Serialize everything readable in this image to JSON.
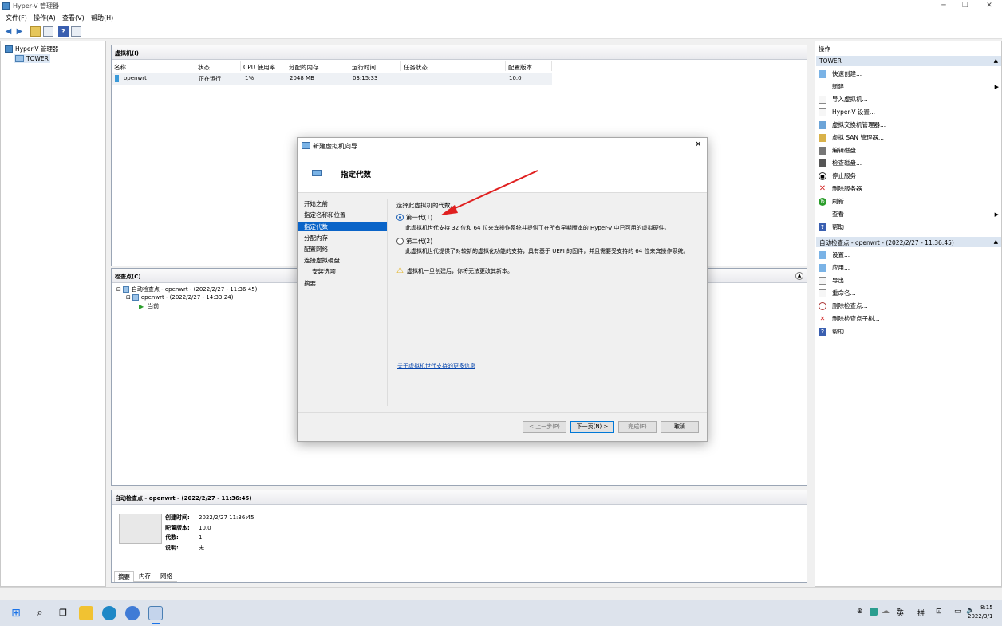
{
  "window": {
    "title": "Hyper-V 管理器",
    "min": "─",
    "max": "❐",
    "close": "✕"
  },
  "menu": [
    "文件(F)",
    "操作(A)",
    "查看(V)",
    "帮助(H)"
  ],
  "tree": {
    "root": "Hyper-V 管理器",
    "server": "TOWER"
  },
  "vmpanel": {
    "title": "虚拟机(I)",
    "columns": [
      "名称",
      "状态",
      "CPU 使用率",
      "分配的内存",
      "运行时间",
      "任务状态",
      "配置版本"
    ],
    "row": [
      "openwrt",
      "正在运行",
      "1%",
      "2048 MB",
      "03:15:33",
      "",
      "10.0"
    ]
  },
  "checkpoints": {
    "title": "检查点(C)",
    "items": [
      "自动检查点 - openwrt - (2022/2/27 - 11:36:45)",
      "openwrt - (2022/2/27 - 14:33:24)",
      "当前"
    ]
  },
  "details": {
    "title": "自动检查点 - openwrt - (2022/2/27 - 11:36:45)",
    "fields": [
      {
        "k": "创建时间:",
        "v": "2022/2/27 11:36:45"
      },
      {
        "k": "配置版本:",
        "v": "10.0"
      },
      {
        "k": "代数:",
        "v": "1"
      },
      {
        "k": "说明:",
        "v": "无"
      }
    ],
    "tabs": [
      "摘要",
      "内存",
      "网络"
    ]
  },
  "actions": {
    "title": "操作",
    "sec1": "TOWER",
    "items1": [
      "快速创建...",
      "新建",
      "导入虚拟机...",
      "Hyper-V 设置...",
      "虚拟交换机管理器...",
      "虚拟 SAN 管理器...",
      "编辑磁盘...",
      "检查磁盘...",
      "停止服务",
      "删除服务器",
      "刷新",
      "查看",
      "帮助"
    ],
    "sec2": "自动检查点 - openwrt - (2022/2/27 - 11:36:45)",
    "items2": [
      "设置...",
      "应用...",
      "导出...",
      "重命名...",
      "删除检查点...",
      "删除检查点子树...",
      "帮助"
    ]
  },
  "dialog": {
    "title": "新建虚拟机向导",
    "heading": "指定代数",
    "nav": [
      "开始之前",
      "指定名称和位置",
      "指定代数",
      "分配内存",
      "配置网络",
      "连接虚拟硬盘",
      "安装选项",
      "摘要"
    ],
    "prompt": "选择此虚拟机的代数。",
    "gen1": "第一代(1)",
    "gen1_desc": "此虚拟机世代支持 32 位和 64 位来宾操作系统并提供了在所有早期版本的 Hyper-V 中已可用的虚拟硬件。",
    "gen2": "第二代(2)",
    "gen2_desc": "此虚拟机世代提供了对较新的虚拟化功能的支持，具有基于 UEFI 的固件，并且需要受支持的 64 位来宾操作系统。",
    "warning": "虚拟机一旦创建后，你将无法更改其新本。",
    "link": "关于虚拟机世代支持的更多信息",
    "buttons": [
      "< 上一步(P)",
      "下一页(N) >",
      "完成(F)",
      "取消"
    ]
  },
  "clock": {
    "time": "8:15",
    "date": "2022/3/1"
  },
  "tray": {
    "lang": "英",
    "ime": "拼"
  }
}
